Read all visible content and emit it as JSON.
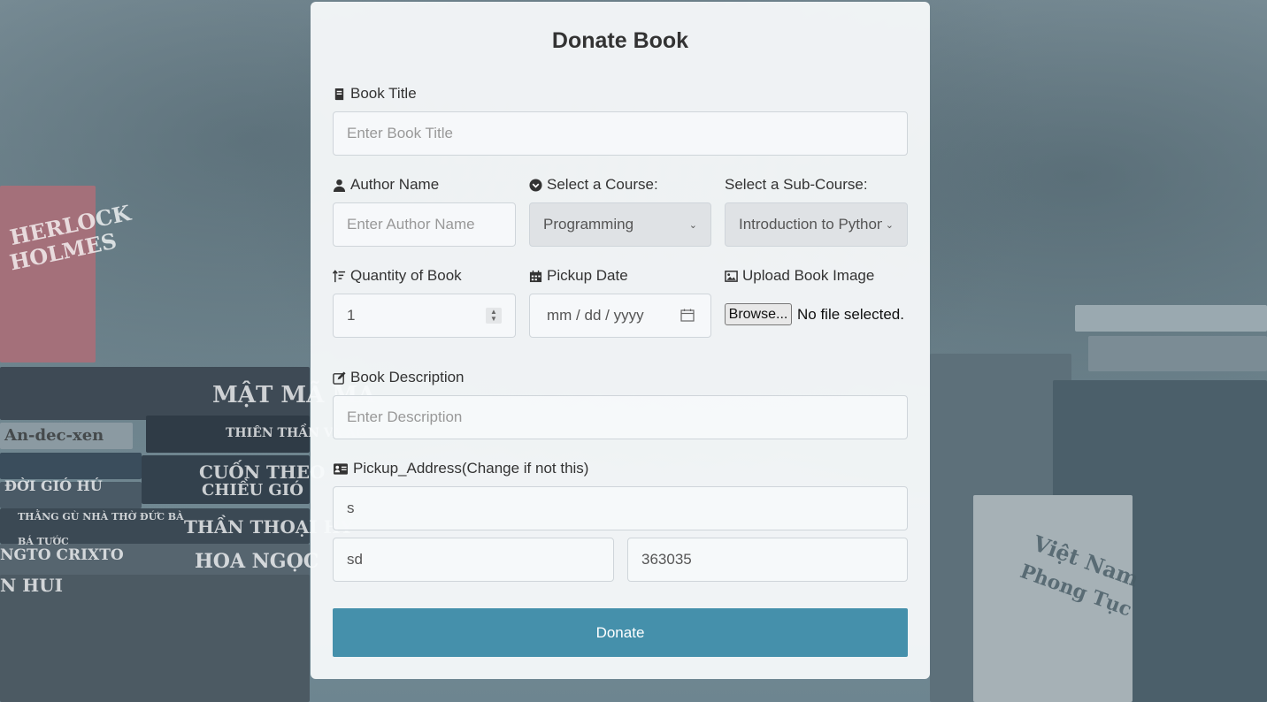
{
  "form": {
    "title": "Donate Book",
    "book_title": {
      "label": "Book Title",
      "placeholder": "Enter Book Title",
      "icon": "book-icon"
    },
    "author": {
      "label": "Author Name",
      "placeholder": "Enter Author Name",
      "icon": "user-icon"
    },
    "course": {
      "label": "Select a Course:",
      "value": "Programming",
      "icon": "check-circle-icon"
    },
    "sub_course": {
      "label": "Select a Sub-Course:",
      "value": "Introduction to Python"
    },
    "quantity": {
      "label": "Quantity of Book",
      "value": "1",
      "icon": "sort-amount-up-icon"
    },
    "pickup_date": {
      "label": "Pickup Date",
      "placeholder": "mm / dd / yyyy",
      "icon": "calendar-icon"
    },
    "upload": {
      "label": "Upload Book Image",
      "browse_label": "Browse...",
      "status": "No file selected.",
      "icon": "image-icon"
    },
    "description": {
      "label": "Book Description",
      "placeholder": "Enter Description",
      "icon": "edit-icon"
    },
    "address": {
      "label": "Pickup_Address(Change if not this)",
      "line1": "s",
      "line2": "sd",
      "pincode": "363035",
      "icon": "address-card-icon"
    },
    "submit_label": "Donate"
  },
  "background": {
    "texts": [
      "HERLOCK",
      "HOLMES",
      "MẬT MÃ MA",
      "An-dec-xen",
      "THIÊN THẦN VÀ ÁC",
      "CUỐN THEO",
      "CHIỀU GIÓ",
      "ĐỜI GIÓ HÚ",
      "THẦN THOẠI HY",
      "HOA NGỌC",
      "NGTO CRIXTO",
      "N HUI",
      "Việt Nam",
      "Phong Tục",
      "THẰNG GÙ NHÀ THỜ ĐỨC BÀ",
      "BÁ TƯỚC"
    ]
  },
  "colors": {
    "accent": "#4590ab",
    "card": "#f8fafb"
  }
}
